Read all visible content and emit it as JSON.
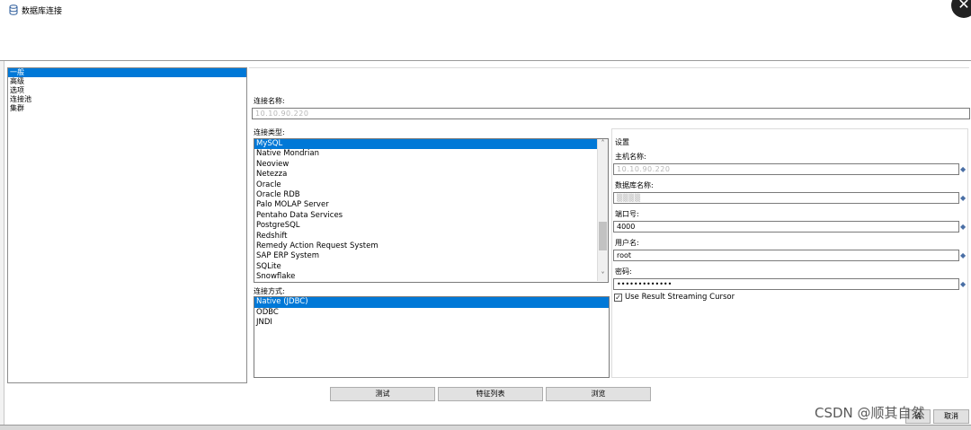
{
  "window": {
    "title": "数据库连接",
    "close_glyph": "✕"
  },
  "nav": {
    "items": [
      {
        "label": "一般",
        "selected": true
      },
      {
        "label": "高级",
        "selected": false
      },
      {
        "label": "选项",
        "selected": false
      },
      {
        "label": "连接池",
        "selected": false
      },
      {
        "label": "集群",
        "selected": false
      }
    ]
  },
  "connection_name": {
    "label": "连接名称:",
    "value": "10.10.90.220"
  },
  "connection_type": {
    "label": "连接类型:",
    "items": [
      {
        "label": "MySQL",
        "selected": true
      },
      {
        "label": "Native Mondrian",
        "selected": false
      },
      {
        "label": "Neoview",
        "selected": false
      },
      {
        "label": "Netezza",
        "selected": false
      },
      {
        "label": "Oracle",
        "selected": false
      },
      {
        "label": "Oracle RDB",
        "selected": false
      },
      {
        "label": "Palo MOLAP Server",
        "selected": false
      },
      {
        "label": "Pentaho Data Services",
        "selected": false
      },
      {
        "label": "PostgreSQL",
        "selected": false
      },
      {
        "label": "Redshift",
        "selected": false
      },
      {
        "label": "Remedy Action Request System",
        "selected": false
      },
      {
        "label": "SAP ERP System",
        "selected": false
      },
      {
        "label": "SQLite",
        "selected": false
      },
      {
        "label": "Snowflake",
        "selected": false
      }
    ],
    "scroll_up": "˄",
    "scroll_down": "˅"
  },
  "access_method": {
    "label": "连接方式:",
    "items": [
      {
        "label": "Native (JDBC)",
        "selected": true
      },
      {
        "label": "ODBC",
        "selected": false
      },
      {
        "label": "JNDI",
        "selected": false
      }
    ]
  },
  "settings": {
    "title": "设置",
    "host_label": "主机名称:",
    "host_value": "10.10.90.220",
    "db_label": "数据库名称:",
    "db_value": "▒▒▒▒",
    "port_label": "端口号:",
    "port_value": "4000",
    "user_label": "用户名:",
    "user_value": "root",
    "password_label": "密码:",
    "password_value": "•••••••••••••",
    "streaming_label": "Use Result Streaming Cursor",
    "streaming_checked": true,
    "check_glyph": "✓",
    "var_icon_glyph": "◆"
  },
  "buttons": {
    "test": "测试",
    "features": "特征列表",
    "explore": "浏览",
    "ok_partial": "确",
    "cancel_partial": "取消"
  },
  "watermark": "CSDN @顺其自然"
}
